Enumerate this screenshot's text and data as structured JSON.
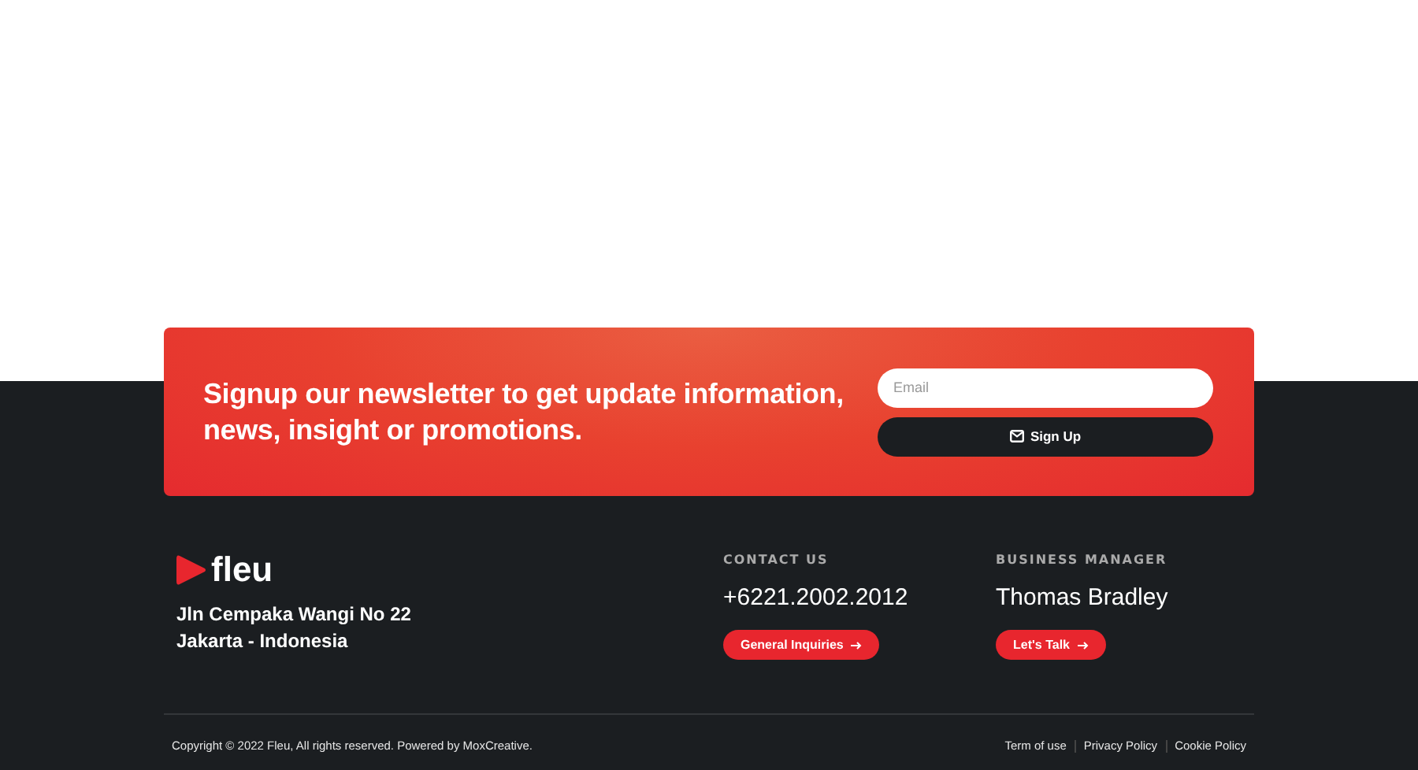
{
  "newsletter": {
    "heading": "Signup our newsletter to get update information, news, insight or promotions.",
    "email": {
      "placeholder": "Email"
    },
    "button": "Sign Up"
  },
  "brand": {
    "name": "fleu",
    "address": [
      "Jln Cempaka Wangi No 22",
      "Jakarta - Indonesia"
    ]
  },
  "contacts": [
    {
      "label": "CONTACT US",
      "value": "+6221.2002.2012",
      "button": "General Inquiries"
    },
    {
      "label": "BUSINESS MANAGER",
      "value": "Thomas Bradley",
      "button": "Let's Talk"
    }
  ],
  "copyright": "Copyright © 2022 Fleu, All rights reserved. Powered by MoxCreative.",
  "links": [
    "Term of use",
    "Privacy Policy",
    "Cookie Policy"
  ]
}
